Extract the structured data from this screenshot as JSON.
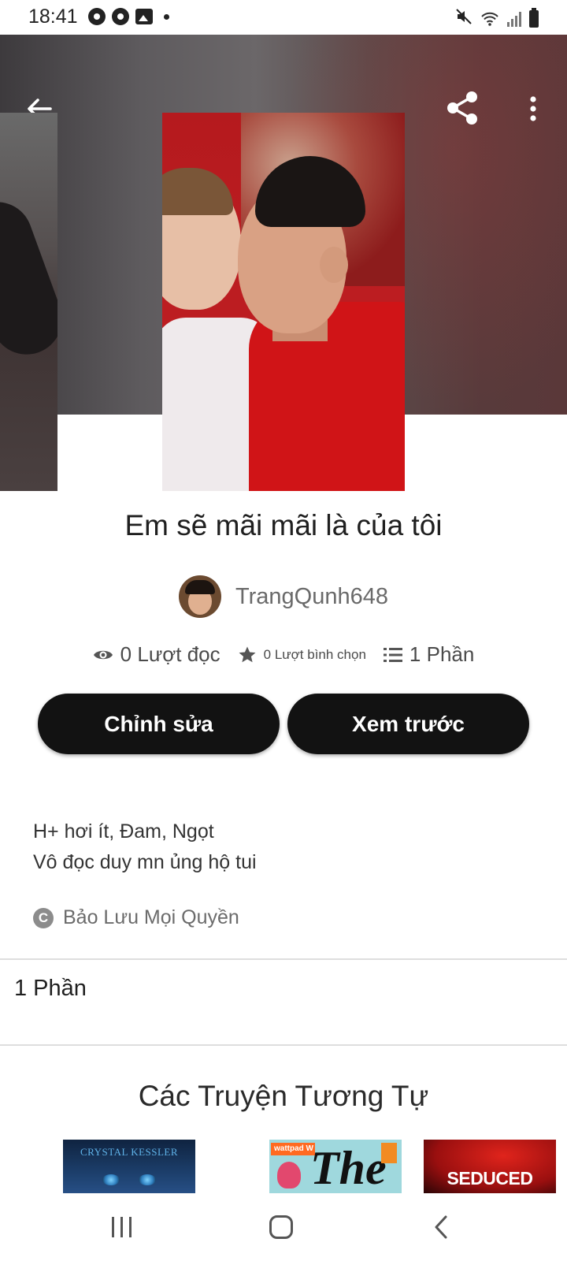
{
  "status_bar": {
    "time": "18:41",
    "left_icons": [
      "chrome-icon",
      "chrome-icon",
      "gallery-icon",
      "notification-dot-icon"
    ],
    "right_icons": [
      "mute-icon",
      "wifi-icon",
      "signal-icon",
      "battery-icon"
    ]
  },
  "toolbar": {
    "back_icon": "arrow-left-icon",
    "share_icon": "share-icon",
    "more_icon": "more-vertical-icon"
  },
  "story": {
    "title": "Em sẽ mãi mãi là của tôi",
    "author": "TrangQunh648",
    "stats": {
      "reads": "0 Lượt đọc",
      "votes": "0 Lượt bình chọn",
      "parts": "1 Phần"
    },
    "buttons": {
      "edit": "Chỉnh sửa",
      "preview": "Xem trước"
    },
    "description_lines": [
      "H+ hơi ít, Đam, Ngọt",
      "Vô đọc duy mn ủng hộ tui"
    ],
    "rights": "Bảo Lưu Mọi Quyền",
    "parts_count": "1 Phần"
  },
  "similar": {
    "title": "Các Truyện Tương Tự",
    "items": [
      {
        "label": "CRYSTAL KESSLER"
      },
      {
        "label": "The",
        "badge": "wattpad W"
      },
      {
        "label": "SEDUCED"
      }
    ]
  },
  "nav_bar": {
    "icons": [
      "recent-apps-icon",
      "home-icon",
      "back-icon"
    ]
  },
  "colors": {
    "button_bg": "#121212",
    "button_text": "#ffffff",
    "divider": "#dedede"
  }
}
